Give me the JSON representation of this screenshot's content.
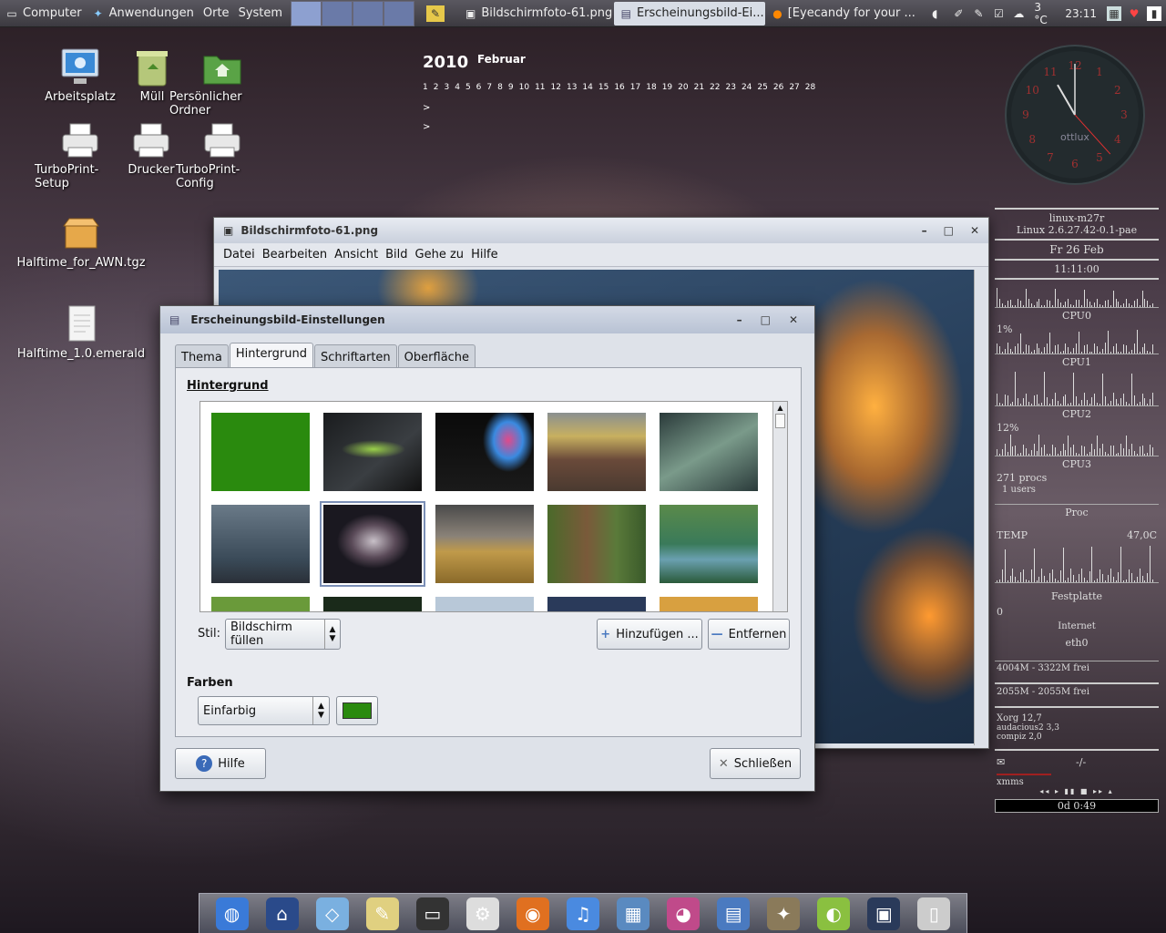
{
  "top_panel": {
    "menus": [
      "Computer",
      "Anwendungen",
      "Orte",
      "System"
    ],
    "tasks": [
      {
        "label": "Bildschirmfoto-61.png",
        "active": false
      },
      {
        "label": "Erscheinungsbild-Ei...",
        "active": true
      },
      {
        "label": "[Eyecandy for your ...",
        "active": false
      }
    ],
    "temperature": "3 °C",
    "time": "23:11"
  },
  "desktop_icons": [
    {
      "label": "Arbeitsplatz",
      "icon": "monitor-icon"
    },
    {
      "label": "Müll",
      "icon": "trash-icon"
    },
    {
      "label": "Persönlicher Ordner",
      "icon": "home-folder-icon"
    },
    {
      "label": "TurboPrint-Setup",
      "icon": "printer-icon"
    },
    {
      "label": "Drucker",
      "icon": "printer-icon"
    },
    {
      "label": "TurboPrint-Config",
      "icon": "printer-icon"
    },
    {
      "label": "Halftime_for_AWN.tgz",
      "icon": "archive-icon"
    },
    {
      "label": "Halftime_1.0.emerald",
      "icon": "document-icon"
    }
  ],
  "calendar": {
    "year": "2010",
    "month": "Februar",
    "days": [
      "1",
      "2",
      "3",
      "4",
      "5",
      "6",
      "7",
      "8",
      "9",
      "10",
      "11",
      "12",
      "13",
      "14",
      "15",
      "16",
      "17",
      "18",
      "19",
      "20",
      "21",
      "22",
      "23",
      "24",
      "25",
      "26",
      "27",
      "28"
    ]
  },
  "clock": {
    "label": "ottlux",
    "hour": 11,
    "minute": 0,
    "second": 23
  },
  "conky": {
    "host": "linux-m27r",
    "kernel": "Linux 2.6.27.42-0.1-pae",
    "date": "Fr 26 Feb",
    "time": "11:11:00",
    "cpu0": "CPU0",
    "cpu1_pct": "1%",
    "cpu1": "CPU1",
    "cpu2": "CPU2",
    "cpu3_pct": "12%",
    "cpu3": "CPU3",
    "procs": "271 procs",
    "users": "1 users",
    "proc": "Proc",
    "temp_label": "TEMP",
    "temp_value": "47,0C",
    "disk": "Festplatte",
    "disk_val": "0",
    "internet": "Internet",
    "iface": "eth0",
    "mem1": "4004M - 3322M frei",
    "mem2": "2055M - 2055M frei",
    "top": [
      "Xorg 12,7",
      "audacious2 3,3",
      "compiz 2,0"
    ],
    "mail_sep": "-/-",
    "player": "xmms",
    "player_time": "0d 0:49"
  },
  "viewer": {
    "title": "Bildschirmfoto-61.png",
    "menu": [
      "Datei",
      "Bearbeiten",
      "Ansicht",
      "Bild",
      "Gehe zu",
      "Hilfe"
    ]
  },
  "dialog": {
    "title": "Erscheinungsbild-Einstellungen",
    "tabs": [
      "Thema",
      "Hintergrund",
      "Schriftarten",
      "Oberfläche"
    ],
    "active_tab": "Hintergrund",
    "section_background": "Hintergrund",
    "style_label": "Stil:",
    "style_value": "Bildschirm füllen",
    "add_button": "Hinzufügen ...",
    "remove_button": "Entfernen",
    "section_colors": "Farben",
    "color_mode": "Einfarbig",
    "color_swatch": "#2a8a0e",
    "help_button": "Hilfe",
    "close_button": "Schließen"
  },
  "dock": {
    "items": [
      "globe-icon",
      "home-icon",
      "network-icon",
      "text-editor-icon",
      "terminal-icon",
      "settings-icon",
      "firefox-icon",
      "itunes-icon",
      "network-computers-icon",
      "office-icon",
      "writer-icon",
      "gimp-icon",
      "lime-icon",
      "screenshot-icon",
      "trash-icon"
    ]
  }
}
